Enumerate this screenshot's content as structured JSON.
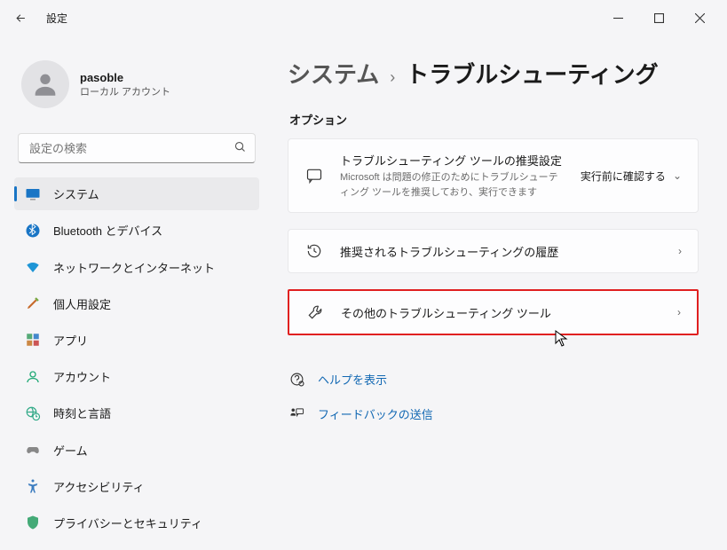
{
  "window": {
    "title": "設定"
  },
  "profile": {
    "name": "pasoble",
    "subtitle": "ローカル アカウント"
  },
  "search": {
    "placeholder": "設定の検索"
  },
  "nav": {
    "system": "システム",
    "bluetooth": "Bluetooth とデバイス",
    "network": "ネットワークとインターネット",
    "personalization": "個人用設定",
    "apps": "アプリ",
    "accounts": "アカウント",
    "time": "時刻と言語",
    "gaming": "ゲーム",
    "accessibility": "アクセシビリティ",
    "privacy": "プライバシーとセキュリティ"
  },
  "breadcrumb": {
    "root": "システム",
    "leaf": "トラブルシューティング"
  },
  "section": "オプション",
  "cards": {
    "recommend": {
      "title": "トラブルシューティング ツールの推奨設定",
      "desc": "Microsoft は問題の修正のためにトラブルシューティング ツールを推奨しており、実行できます",
      "action": "実行前に確認する"
    },
    "history": {
      "title": "推奨されるトラブルシューティングの履歴"
    },
    "other": {
      "title": "その他のトラブルシューティング ツール"
    }
  },
  "links": {
    "help": "ヘルプを表示",
    "feedback": "フィードバックの送信"
  }
}
